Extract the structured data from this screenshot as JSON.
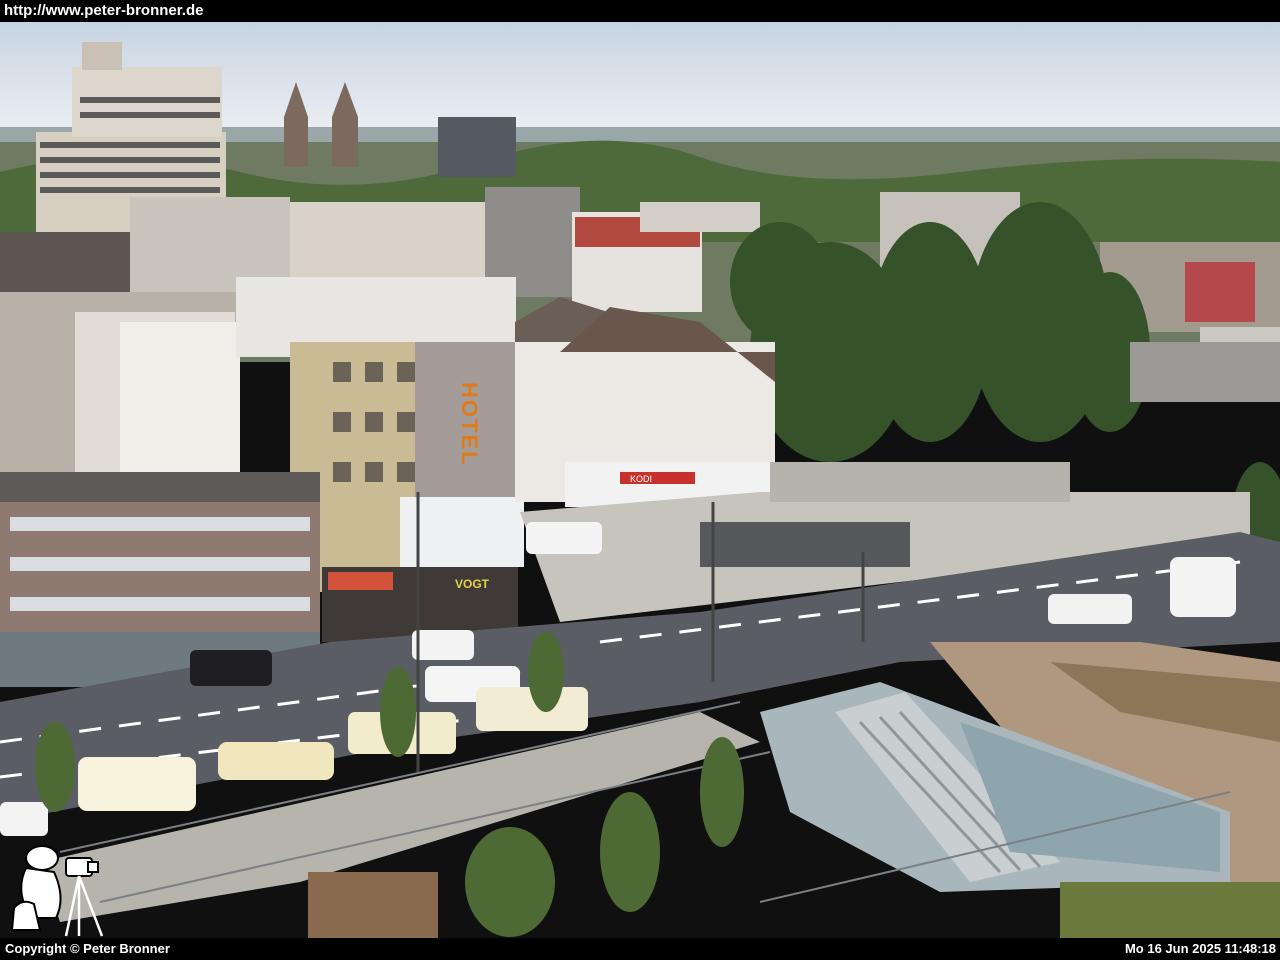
{
  "header": {
    "url": "http://www.peter-bronner.de"
  },
  "footer": {
    "copyright": "Copyright © Peter Bronner",
    "timestamp": "Mo 16 Jun 2025 11:48:18"
  },
  "scene": {
    "hotel_sign": "HOTEL",
    "shop_sign": "VOGT",
    "store_sign": "KODI"
  },
  "colors": {
    "sky": "#e6ecf2",
    "road": "#5a5d63",
    "tree": "#3c5a2a",
    "hotel_sign": "#e07a1a"
  },
  "icons": {
    "photographer_logo": "photographer-with-camera-icon"
  }
}
